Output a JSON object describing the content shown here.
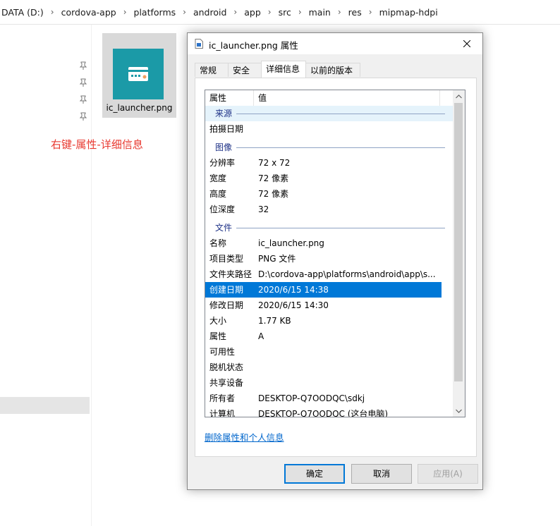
{
  "breadcrumb": [
    "DATA (D:)",
    "cordova-app",
    "platforms",
    "android",
    "app",
    "src",
    "main",
    "res",
    "mipmap-hdpi"
  ],
  "file": {
    "name": "ic_launcher.png"
  },
  "annotation": "右键-属性-详细信息",
  "dialog": {
    "title": "ic_launcher.png 属性",
    "tabs": [
      "常规",
      "安全",
      "详细信息",
      "以前的版本"
    ],
    "active_tab": "详细信息",
    "columns": {
      "property": "属性",
      "value": "值"
    },
    "groups": {
      "source": "来源",
      "image": "图像",
      "file": "文件"
    },
    "source_rows": [
      {
        "key": "拍摄日期",
        "value": ""
      }
    ],
    "image_rows": [
      {
        "key": "分辨率",
        "value": "72 x 72"
      },
      {
        "key": "宽度",
        "value": "72 像素"
      },
      {
        "key": "高度",
        "value": "72 像素"
      },
      {
        "key": "位深度",
        "value": "32"
      }
    ],
    "file_rows": [
      {
        "key": "名称",
        "value": "ic_launcher.png"
      },
      {
        "key": "项目类型",
        "value": "PNG 文件"
      },
      {
        "key": "文件夹路径",
        "value": "D:\\cordova-app\\platforms\\android\\app\\s..."
      },
      {
        "key": "创建日期",
        "value": "2020/6/15 14:38"
      },
      {
        "key": "修改日期",
        "value": "2020/6/15 14:30"
      },
      {
        "key": "大小",
        "value": "1.77 KB"
      },
      {
        "key": "属性",
        "value": "A"
      },
      {
        "key": "可用性",
        "value": ""
      },
      {
        "key": "脱机状态",
        "value": ""
      },
      {
        "key": "共享设备",
        "value": ""
      },
      {
        "key": "所有者",
        "value": "DESKTOP-Q7OODQC\\sdkj"
      },
      {
        "key": "计算机",
        "value": "DESKTOP-Q7OODQC (这台电脑)"
      }
    ],
    "selected_row": "创建日期",
    "remove_link": "删除属性和个人信息",
    "buttons": {
      "ok": "确定",
      "cancel": "取消",
      "apply": "应用(A)"
    }
  },
  "colors": {
    "selection": "#0078d7",
    "annotation": "#e8382f",
    "link": "#0066cc",
    "icon_bg": "#1b9aa7"
  }
}
